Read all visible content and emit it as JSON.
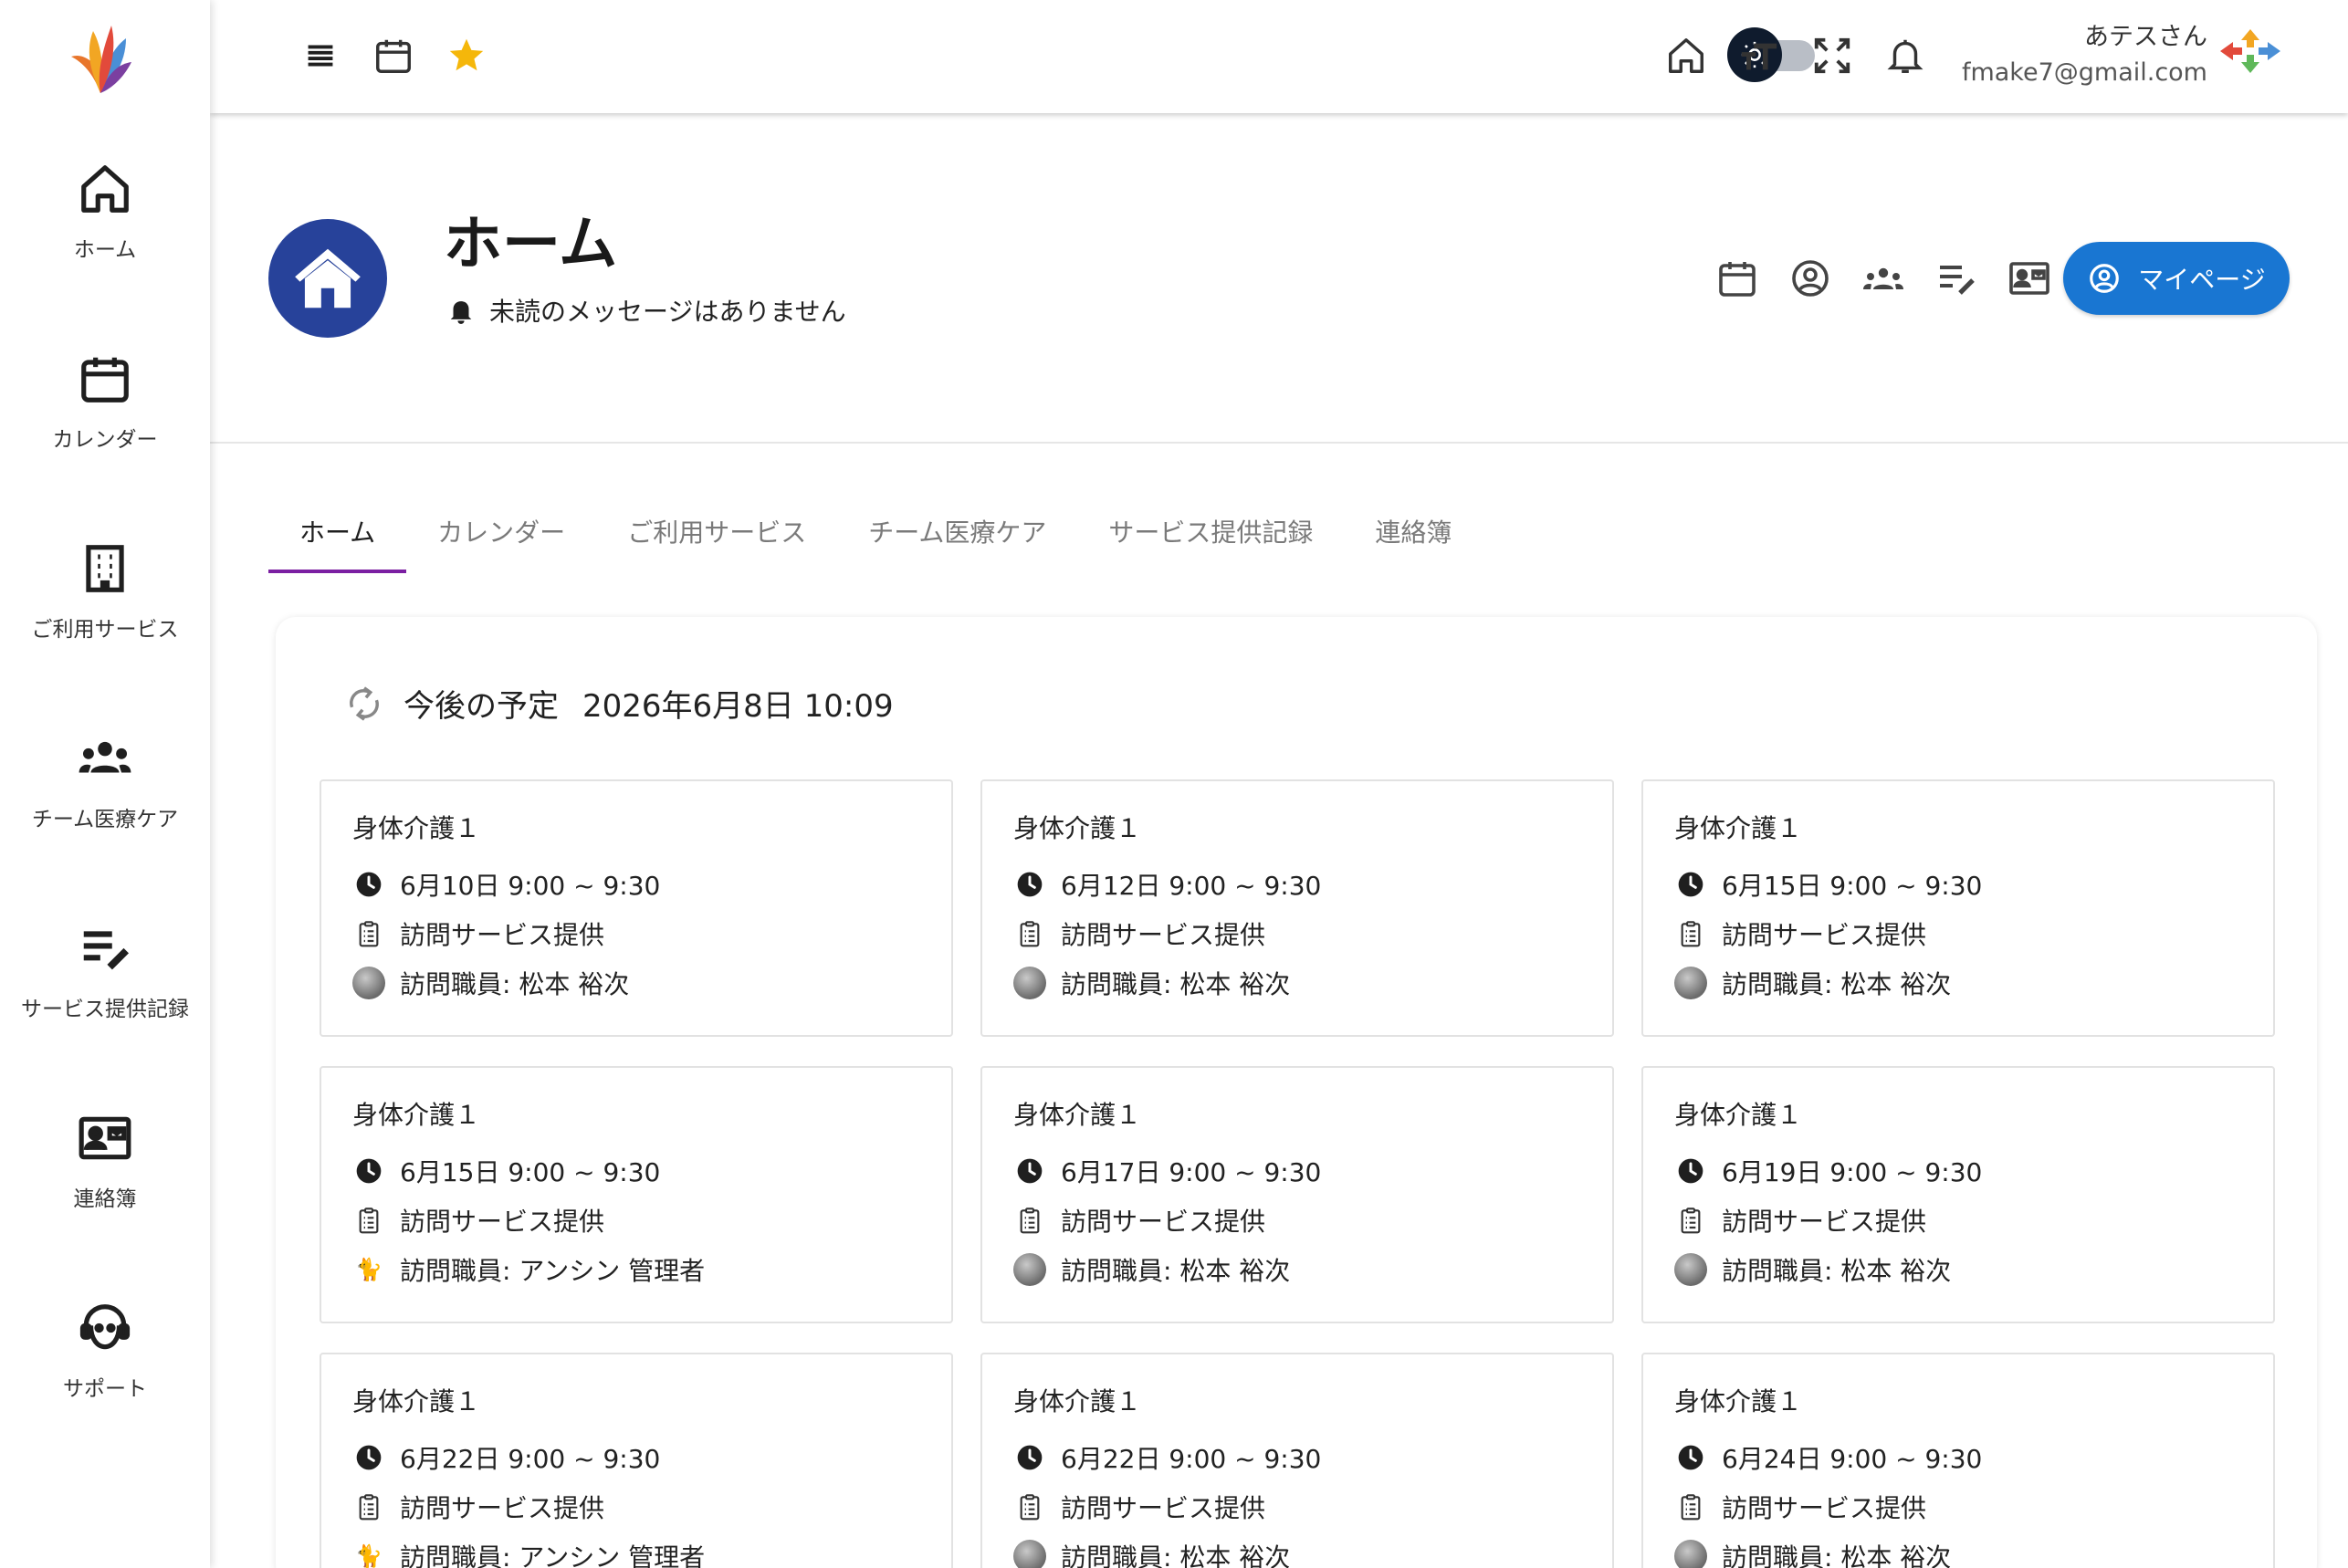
{
  "header": {
    "user_name": "あテスさん",
    "user_email": "fmake7@gmail.com",
    "icons": [
      "menu-icon",
      "calendar-icon",
      "star-icon",
      "theme-toggle",
      "home-icon",
      "font-size-icon",
      "fullscreen-icon",
      "bell-icon"
    ],
    "colors": {
      "star": "#f5b70a",
      "toggle_knob": "#0f1b2d"
    }
  },
  "sidebar": {
    "items": [
      {
        "label": "ホーム",
        "icon": "home-icon"
      },
      {
        "label": "カレンダー",
        "icon": "calendar-icon"
      },
      {
        "label": "ご利用サービス",
        "icon": "building-icon"
      },
      {
        "label": "チーム医療ケア",
        "icon": "group-icon"
      },
      {
        "label": "サービス提供記録",
        "icon": "edit-note-icon"
      },
      {
        "label": "連絡簿",
        "icon": "contact-card-icon"
      },
      {
        "label": "サポート",
        "icon": "support-agent-icon"
      }
    ]
  },
  "hero": {
    "title": "ホーム",
    "message": "未読のメッセージはありません",
    "mypage_button": "マイページ",
    "colors": {
      "avatar": "#27429a",
      "button": "#1976d2"
    }
  },
  "tabs": [
    {
      "label": "ホーム",
      "active": true
    },
    {
      "label": "カレンダー",
      "active": false
    },
    {
      "label": "ご利用サービス",
      "active": false
    },
    {
      "label": "チーム医療ケア",
      "active": false
    },
    {
      "label": "サービス提供記録",
      "active": false
    },
    {
      "label": "連絡簿",
      "active": false
    }
  ],
  "schedule": {
    "heading": "今後の予定",
    "datetime": "2026年6月8日 10:09",
    "appointments": [
      {
        "title": "身体介護１",
        "time": "6月10日 9:00 ~ 9:30",
        "service": "訪問サービス提供",
        "staff": "訪問職員: 松本 裕次",
        "avatar": "a"
      },
      {
        "title": "身体介護１",
        "time": "6月12日 9:00 ~ 9:30",
        "service": "訪問サービス提供",
        "staff": "訪問職員: 松本 裕次",
        "avatar": "a"
      },
      {
        "title": "身体介護１",
        "time": "6月15日 9:00 ~ 9:30",
        "service": "訪問サービス提供",
        "staff": "訪問職員: 松本 裕次",
        "avatar": "a"
      },
      {
        "title": "身体介護１",
        "time": "6月15日 9:00 ~ 9:30",
        "service": "訪問サービス提供",
        "staff": "訪問職員: アンシン 管理者",
        "avatar": "b"
      },
      {
        "title": "身体介護１",
        "time": "6月17日 9:00 ~ 9:30",
        "service": "訪問サービス提供",
        "staff": "訪問職員: 松本 裕次",
        "avatar": "a"
      },
      {
        "title": "身体介護１",
        "time": "6月19日 9:00 ~ 9:30",
        "service": "訪問サービス提供",
        "staff": "訪問職員: 松本 裕次",
        "avatar": "a"
      },
      {
        "title": "身体介護１",
        "time": "6月22日 9:00 ~ 9:30",
        "service": "訪問サービス提供",
        "staff": "訪問職員: アンシン 管理者",
        "avatar": "b"
      },
      {
        "title": "身体介護１",
        "time": "6月22日 9:00 ~ 9:30",
        "service": "訪問サービス提供",
        "staff": "訪問職員: 松本 裕次",
        "avatar": "a"
      },
      {
        "title": "身体介護１",
        "time": "6月24日 9:00 ~ 9:30",
        "service": "訪問サービス提供",
        "staff": "訪問職員: 松本 裕次",
        "avatar": "a"
      }
    ]
  }
}
